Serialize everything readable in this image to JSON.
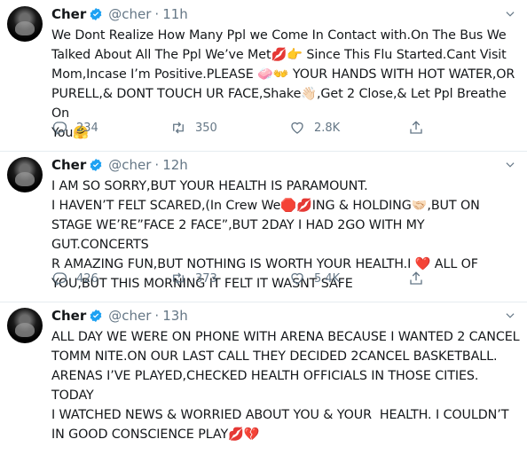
{
  "tweets": [
    {
      "name": "Cher",
      "handle": "@cher",
      "time": "11h",
      "text": "We Dont Realize How Many Ppl we Come In Contact with.On The Bus We\nTalked About All The Ppl We’ve Met💋👉 Since This Flu Started.Cant Visit\nMom,Incase I’m Positive.PLEASE 🧼👐 YOUR HANDS WITH HOT WATER,OR\nPURELL,& DONT TOUCH UR FACE,Shake👋🏻,Get 2 Close,& Let Ppl Breathe On\nYou🤗",
      "replies": "234",
      "retweets": "350",
      "likes": "2.8K"
    },
    {
      "name": "Cher",
      "handle": "@cher",
      "time": "12h",
      "text": "I AM SO SORRY,BUT YOUR HEALTH IS PARAMOUNT.\nI HAVEN’T FELT SCARED,(In Crew We🛑💋ING & HOLDING🤝🏻,BUT ON\nSTAGE WE’RE”FACE 2 FACE”,BUT 2DAY I HAD 2GO WITH MY GUT.CONCERTS\nR AMAZING FUN,BUT NOTHING IS WORTH YOUR HEALTH.I ❤️ ALL OF\nYOU,BUT THIS MORNING IT FELT IT WASNT SAFE",
      "replies": "426",
      "retweets": "373",
      "likes": "5.4K"
    },
    {
      "name": "Cher",
      "handle": "@cher",
      "time": "13h",
      "text": "ALL DAY WE WERE ON PHONE WITH ARENA BECAUSE I WANTED 2 CANCEL\nTOMM NITE.ON OUR LAST CALL THEY DECIDED 2CANCEL BASKETBALL.\nARENAS I’VE PLAYED,CHECKED HEALTH OFFICIALS IN THOSE CITIES. TODAY\nI WATCHED NEWS & WORRIED ABOUT YOU & YOUR  HEALTH. I COULDN’T\nIN GOOD CONSCIENCE PLAY💋💔",
      "replies": "",
      "retweets": "",
      "likes": ""
    }
  ],
  "icons": {
    "verified": "verified-badge-icon",
    "caret": "chevron-down-icon",
    "reply": "reply-icon",
    "retweet": "retweet-icon",
    "like": "heart-icon",
    "share": "share-icon"
  },
  "colors": {
    "verified": "#1da1f2",
    "icon_gray": "#657786",
    "border": "#e6ecf0",
    "text": "#14171a"
  }
}
